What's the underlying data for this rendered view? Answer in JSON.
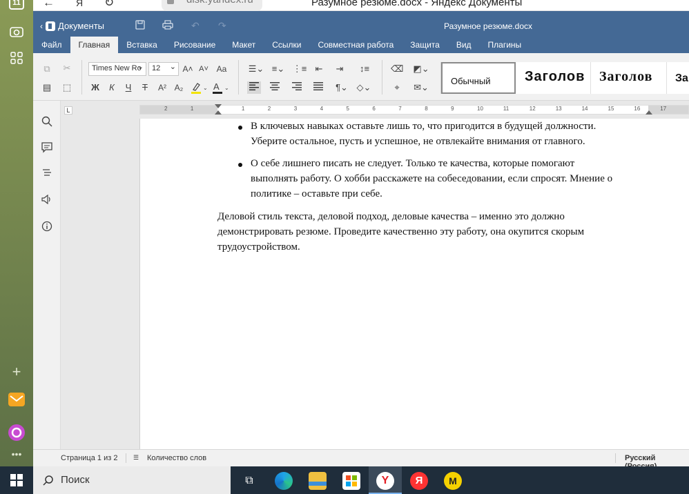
{
  "browser": {
    "tab_count": "11",
    "url": "disk.yandex.ru",
    "window_title": "Разумное резюме.docx - Яндекс Документы",
    "back_icon": "arrow-left-icon",
    "reload_icon": "reload-icon"
  },
  "editor": {
    "back_label": "Документы",
    "doc_title": "Разумное резюме.docx",
    "tabs": [
      "Файл",
      "Главная",
      "Вставка",
      "Рисование",
      "Макет",
      "Ссылки",
      "Совместная работа",
      "Защита",
      "Вид",
      "Плагины"
    ],
    "active_tab": "Главная"
  },
  "toolbar": {
    "font_name": "Times New Ro",
    "font_size": "12",
    "styles": [
      "Обычный",
      "Заголов",
      "Заголов",
      "За"
    ],
    "bold": "Ж",
    "italic": "К",
    "underline": "Ч",
    "strike": "Т",
    "superscript": "A²",
    "subscript": "A₂",
    "grow_font": "A˄",
    "shrink_font": "A˅",
    "change_case": "Aa"
  },
  "ruler": {
    "marks": [
      "2",
      "1",
      "1",
      "2",
      "3",
      "4",
      "5",
      "6",
      "7",
      "8",
      "9",
      "10",
      "11",
      "12",
      "13",
      "14",
      "15",
      "16",
      "17"
    ]
  },
  "document": {
    "bullets": [
      [
        "В ключевых навыках оставьте лишь то, что пригодится в будущей должности.",
        "Уберите остальное, пусть и успешное, не отвлекайте внимания от главного."
      ],
      [
        "О себе лишнего писать не следует. Только те качества, которые помогают",
        "выполнять работу. О хобби расскажете на собеседовании, если спросят. Мнение о",
        "политике – оставьте при себе."
      ]
    ],
    "paragraph": [
      "Деловой стиль текста, деловой подход, деловые качества – именно это должно",
      "демонстрировать резюме. Проведите качественно эту работу, она окупится скорым",
      "трудоустройством."
    ]
  },
  "status": {
    "page": "Страница 1 из 2",
    "word_count": "Количество слов",
    "language": "Русский (Россия)"
  },
  "taskbar": {
    "search_placeholder": "Поиск"
  },
  "colors": {
    "header": "#446995",
    "sidebar": "#7a8a4f",
    "taskbar": "#1f2d3b"
  }
}
